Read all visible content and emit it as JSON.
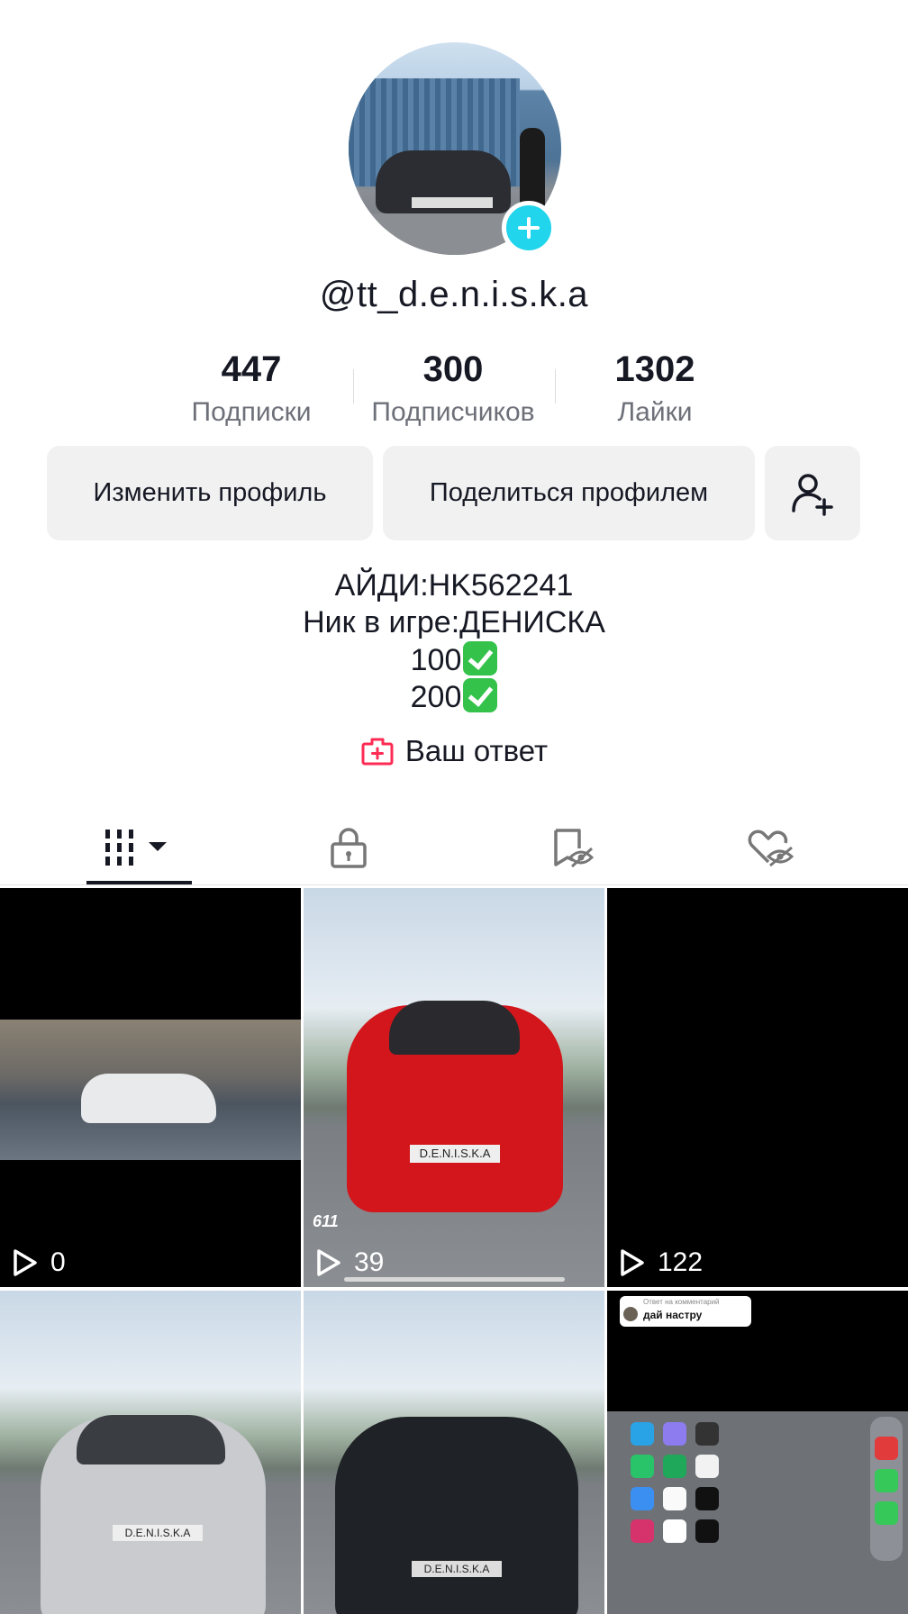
{
  "profile": {
    "username": "@tt_d.e.n.i.s.k.a",
    "stats": [
      {
        "value": "447",
        "label": "Подписки"
      },
      {
        "value": "300",
        "label": "Подписчиков"
      },
      {
        "value": "1302",
        "label": "Лайки"
      }
    ],
    "buttons": {
      "edit": "Изменить профиль",
      "share": "Поделиться профилем"
    },
    "bio": {
      "line1": "АЙДИ:HK562241",
      "line2": "Ник в игре:ДЕНИСКА",
      "line3": "100",
      "line4": "200"
    },
    "answer_label": "Ваш ответ"
  },
  "tabs": [
    {
      "icon": "grid-icon",
      "active": true
    },
    {
      "icon": "lock-icon"
    },
    {
      "icon": "bookmark-hidden-icon"
    },
    {
      "icon": "heart-hidden-icon"
    }
  ],
  "videos": [
    {
      "views": "0"
    },
    {
      "views": "39"
    },
    {
      "views": "122"
    },
    {
      "views": ""
    },
    {
      "views": ""
    },
    {
      "views": ""
    }
  ],
  "thumb_texts": {
    "plate": "D.E.N.I.S.K.A",
    "speed": "611",
    "reply_header": "Ответ на комментарий",
    "reply_text": "дай настру"
  },
  "colors": {
    "accent": "#fe2c55",
    "badge": "#20d5ec",
    "check": "#34c24a"
  }
}
